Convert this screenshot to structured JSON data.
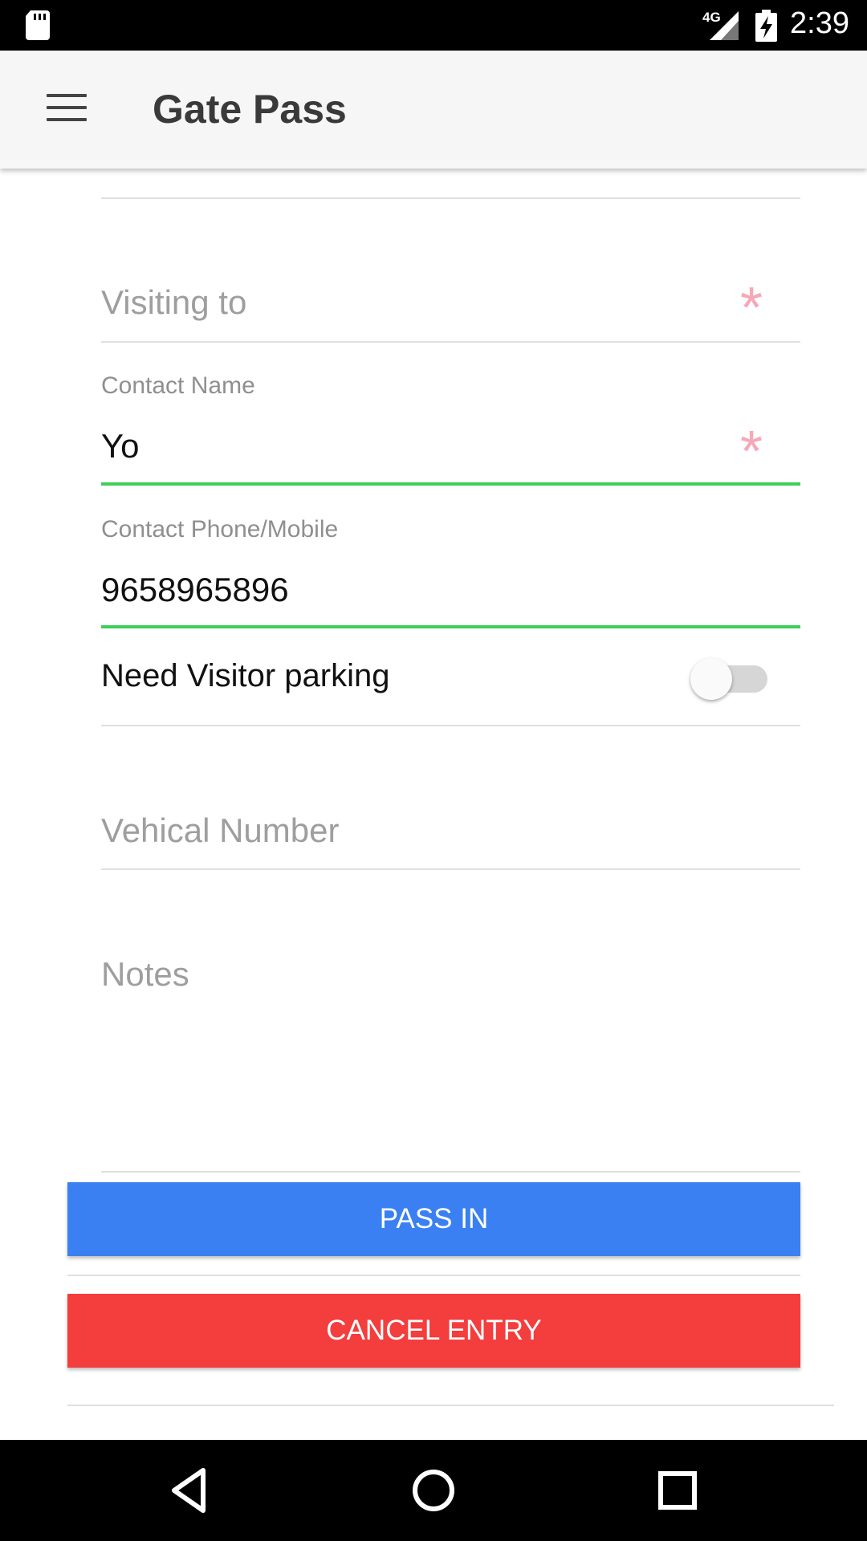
{
  "status_bar": {
    "network": "4G",
    "time": "2:39",
    "icons": [
      "sd-card-icon",
      "signal-icon",
      "battery-icon"
    ]
  },
  "app_bar": {
    "title": "Gate Pass",
    "menu_icon": "hamburger-menu-icon"
  },
  "form": {
    "visiting_to": {
      "placeholder": "Visiting to",
      "required_mark": "*"
    },
    "contact_name": {
      "label": "Contact Name",
      "value": "Yo",
      "required_mark": "*"
    },
    "contact_phone": {
      "label": "Contact Phone/Mobile",
      "value": "9658965896"
    },
    "visitor_parking": {
      "label": "Need Visitor parking",
      "enabled": false
    },
    "vehicle_number": {
      "placeholder": "Vehical Number"
    },
    "notes": {
      "placeholder": "Notes"
    }
  },
  "actions": {
    "pass_in": "PASS IN",
    "cancel_entry": "CANCEL ENTRY"
  },
  "colors": {
    "pass_in": "#3a80f2",
    "cancel_entry": "#f43d3d",
    "active_underline": "#3ecf5a",
    "required_mark": "#f7a8b8"
  },
  "nav_bar": {
    "buttons": [
      "back-icon",
      "home-icon",
      "recents-icon"
    ]
  }
}
